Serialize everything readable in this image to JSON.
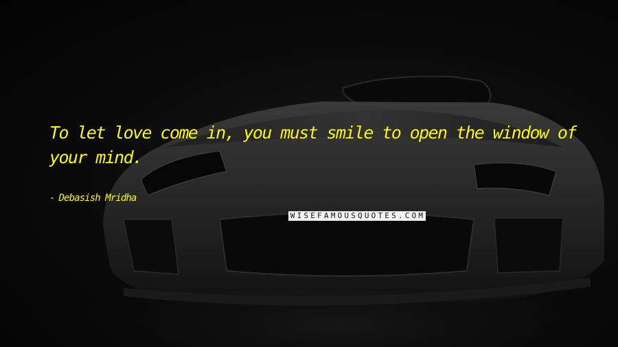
{
  "quote": {
    "text": "To let love come in, you must smile to open the window of your mind.",
    "author": "Debasish Mridha",
    "author_prefix": "-"
  },
  "watermark": {
    "text": "WISEFAMOUSQUOTES.COM"
  },
  "colors": {
    "quote_text": "#ffff00",
    "background": "#050505",
    "watermark_bg": "#f2f2f2",
    "watermark_text": "#111111"
  }
}
